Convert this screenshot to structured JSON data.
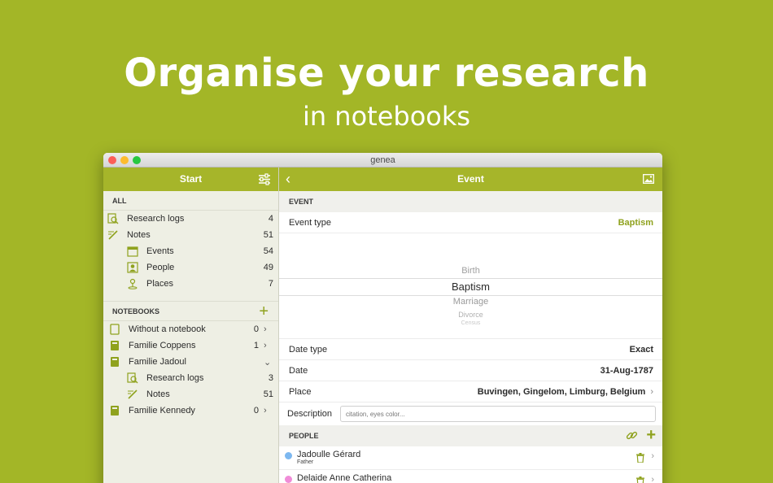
{
  "headline": "Organise your research",
  "subline": "in notebooks",
  "window_title": "genea",
  "sidebar": {
    "title": "Start",
    "all_title": "ALL",
    "all_items": [
      {
        "label": "Research logs",
        "count": "4",
        "icon": "research-log-icon"
      },
      {
        "label": "Notes",
        "count": "51",
        "icon": "note-icon"
      },
      {
        "label": "Events",
        "count": "54",
        "icon": "calendar-icon"
      },
      {
        "label": "People",
        "count": "49",
        "icon": "person-icon"
      },
      {
        "label": "Places",
        "count": "7",
        "icon": "map-pin-icon"
      }
    ],
    "notebooks_title": "NOTEBOOKS",
    "notebooks": [
      {
        "label": "Without a notebook",
        "count": "0",
        "chevron": "›"
      },
      {
        "label": "Familie Coppens",
        "count": "1",
        "chevron": "›"
      },
      {
        "label": "Familie Jadoul",
        "count": "",
        "chevron": "⌄"
      },
      {
        "label": "Research logs",
        "count": "3"
      },
      {
        "label": "Notes",
        "count": "51"
      },
      {
        "label": "Familie Kennedy",
        "count": "0",
        "chevron": "›"
      }
    ]
  },
  "main": {
    "title": "Event",
    "event_section": "EVENT",
    "event_type_label": "Event type",
    "event_type_value": "Baptism",
    "picker_options": [
      "Birth",
      "Baptism",
      "Marriage",
      "Divorce",
      "Census"
    ],
    "date_type_label": "Date type",
    "date_type_value": "Exact",
    "date_label": "Date",
    "date_value": "31-Aug-1787",
    "place_label": "Place",
    "place_value": "Buvingen, Gingelom, Limburg, Belgium",
    "description_label": "Description",
    "description_placeholder": "citation, eyes color...",
    "people_section": "PEOPLE",
    "people": [
      {
        "name": "Jadoulle Gérard",
        "role": "Father",
        "color": "#7db8f0"
      },
      {
        "name": "Delaide Anne Catherina",
        "role": "",
        "color": "#f08cd8"
      }
    ]
  },
  "colors": {
    "accent": "#a6b52a",
    "background": "#a3b627"
  }
}
